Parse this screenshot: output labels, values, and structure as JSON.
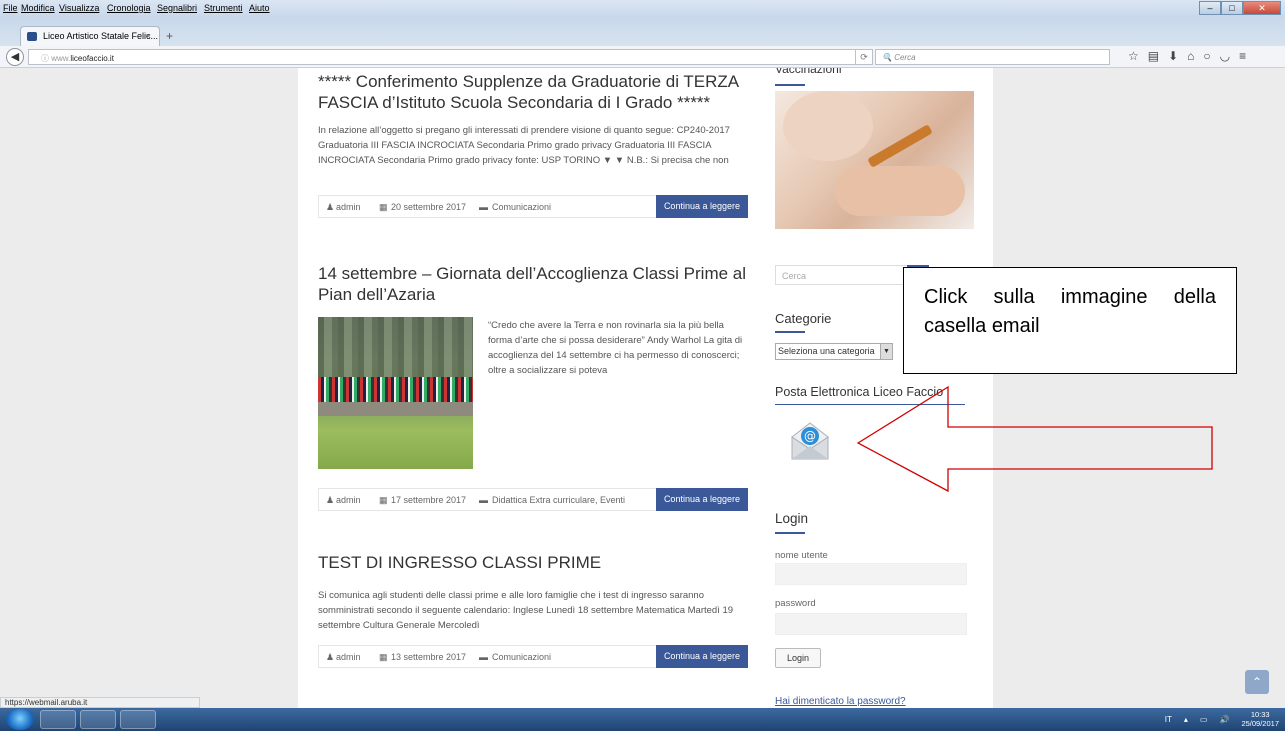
{
  "menubar": {
    "items": [
      "File",
      "Modifica",
      "Visualizza",
      "Cronologia",
      "Segnalibri",
      "Strumenti",
      "Aiuto"
    ]
  },
  "tab": {
    "title": "Liceo Artistico Statale Felic...",
    "close": "×",
    "new": "+"
  },
  "navbar": {
    "url_prefix": "www.",
    "url_domain": "liceofaccio.it",
    "search_placeholder": "Cerca"
  },
  "posts": [
    {
      "title": "***** Conferimento Supplenze da Graduatorie di TERZA FASCIA d’Istituto Scuola Secondaria di I Grado *****",
      "excerpt": "In relazione all’oggetto si pregano gli interessati di prendere visione di quanto segue: CP240-2017 Graduatoria III FASCIA INCROCIATA Secondaria Primo grado privacy Graduatoria III FASCIA INCROCIATA Secondaria Primo grado privacy fonte: USP TORINO ▼ ▼ N.B.: Si precisa che non",
      "author": "admin",
      "date": "20 settembre 2017",
      "category": "Comunicazioni",
      "read_more": "Continua a leggere"
    },
    {
      "title": "14 settembre – Giornata dell’Accoglienza Classi Prime al Pian dell’Azaria",
      "excerpt": "“Credo che avere la Terra e non rovinarla sia la più bella forma d’arte che si possa desiderare”   Andy Warhol La gita di accoglienza del 14 settembre ci ha permesso di conoscerci; oltre a socializzare si poteva",
      "author": "admin",
      "date": "17 settembre 2017",
      "category": "Didattica Extra curriculare, Eventi",
      "read_more": "Continua a leggere"
    },
    {
      "title": "TEST DI INGRESSO CLASSI PRIME",
      "excerpt": "Si comunica agli studenti delle classi prime e alle loro famiglie che i test di ingresso saranno somministrati secondo il seguente calendario: Inglese              Lunedì 18 settembre Matematica        Martedì 19 settembre Cultura Generale  Mercoledì",
      "author": "admin",
      "date": "13 settembre 2017",
      "category": "Comunicazioni",
      "read_more": "Continua a leggere"
    }
  ],
  "sidebar": {
    "vaccinazioni_title": "Vaccinazioni",
    "search_placeholder": "Cerca",
    "categorie_title": "Categorie",
    "categorie_select": "Seleziona una categoria",
    "posta_title": "Posta Elettronica Liceo Faccio",
    "login_title": "Login",
    "username_label": "nome utente",
    "password_label": "password",
    "login_button": "Login",
    "forgot_link": "Hai dimenticato la password?"
  },
  "annotation": {
    "callout_text": "Click sulla immagine della casella email",
    "arrow_color": "#d00000"
  },
  "statusbar": {
    "url": "https://webmail.aruba.it"
  },
  "taskbar": {
    "lang": "IT",
    "time": "10:33",
    "date": "25/09/2017"
  },
  "colors": {
    "accent": "#3b5998"
  }
}
